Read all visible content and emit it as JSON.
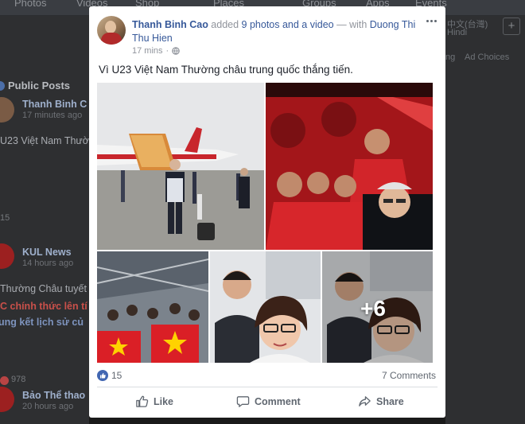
{
  "background": {
    "nav_tabs": [
      "Photos",
      "Videos",
      "Shop",
      "Places",
      "Groups",
      "Apps",
      "Events"
    ],
    "section_title": "Public Posts",
    "posts": [
      {
        "name": "Thanh Binh C",
        "time": "17 minutes ago",
        "text": "U23 Việt Nam Thườ",
        "count": "15"
      },
      {
        "name": "KUL News",
        "time": "14 hours ago",
        "text": "Thường Châu tuyết",
        "headline_1": "C chính thức lên tí",
        "headline_2": "ung kết lịch sử củ",
        "count": "978"
      },
      {
        "name": "Bảo Thể thao",
        "time": "20 hours ago"
      }
    ],
    "right_texts": [
      "中文(台灣)",
      "Hindi",
      "ng",
      "Ad Choices"
    ],
    "right_button": "+"
  },
  "post": {
    "author": "Thanh Binh Cao",
    "action_text": " added ",
    "media_link": "9 photos and a video",
    "with_text": " — with ",
    "tagged": "Duong Thi Thu Hien",
    "time": "17 mins",
    "caption": "Vì U23 Việt Nam Thường châu trung quốc thắng tiến.",
    "more_photos": "+6",
    "reaction_count": "15",
    "comments": "7 Comments",
    "actions": {
      "like": "Like",
      "comment": "Comment",
      "share": "Share"
    }
  },
  "colors": {
    "link": "#365899",
    "like_badge": "#4267b2",
    "action_text": "#606770",
    "overlay": "#1a1a1a"
  }
}
